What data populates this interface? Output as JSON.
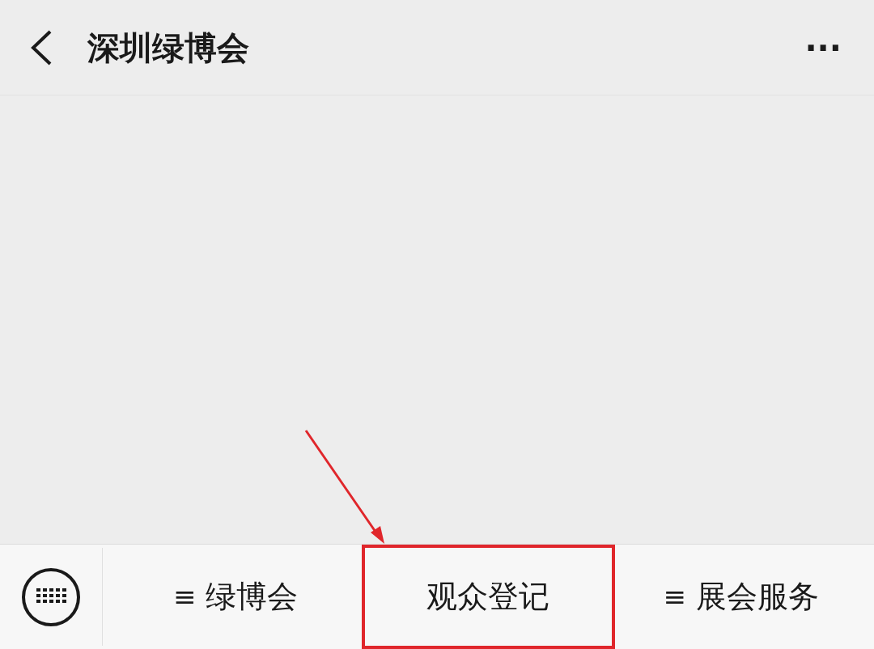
{
  "header": {
    "title": "深圳绿博会",
    "more": "···"
  },
  "menu": {
    "items": [
      {
        "prefix": "≡",
        "label": "绿博会",
        "highlighted": false
      },
      {
        "label": "观众登记",
        "highlighted": true
      },
      {
        "prefix": "≡",
        "label": "展会服务",
        "highlighted": false
      }
    ]
  }
}
